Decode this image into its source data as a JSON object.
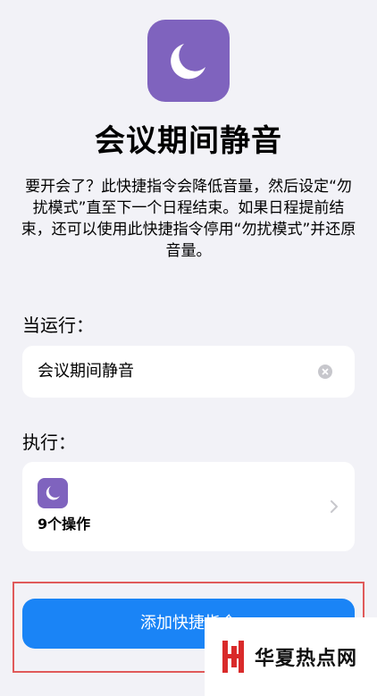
{
  "header": {
    "icon": "moon-icon",
    "title": "会议期间静音",
    "description": "要开会了？此快捷指令会降低音量，然后设定“勿扰模式”直至下一个日程结束。如果日程提前结束，还可以使用此快捷指令停用“勿扰模式”并还原音量。"
  },
  "when": {
    "label": "当运行：",
    "value": "会议期间静音"
  },
  "execute": {
    "label": "执行：",
    "icon": "moon-icon",
    "count": "9个操作"
  },
  "action": {
    "button_label": "添加快捷指令"
  },
  "watermark": {
    "text": "华夏热点网"
  },
  "colors": {
    "accent": "#1a84f6",
    "icon_bg": "#7f63be",
    "highlight": "#e05a5a",
    "background": "#f2f2f7"
  }
}
